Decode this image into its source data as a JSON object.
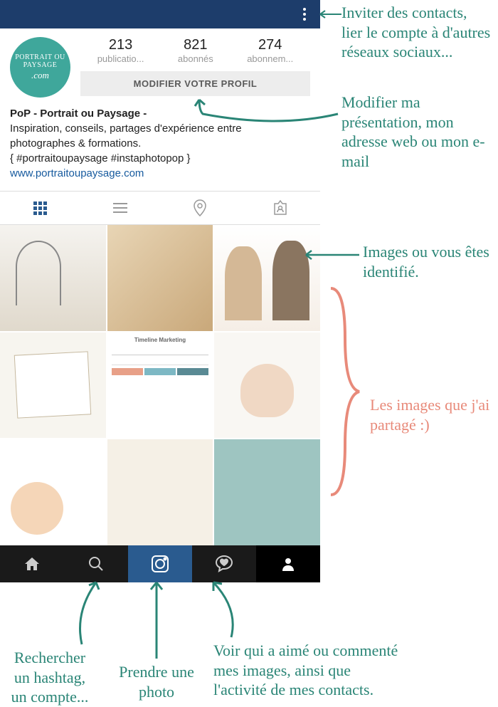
{
  "profile": {
    "avatar_line1": "PORTRAIT OU PAYSAGE",
    "avatar_line2": ".com",
    "stats": {
      "posts": {
        "count": "213",
        "label": "publicatio..."
      },
      "followers": {
        "count": "821",
        "label": "abonnés"
      },
      "following": {
        "count": "274",
        "label": "abonnem..."
      }
    },
    "edit_button": "MODIFIER VOTRE PROFIL",
    "name": "PoP - Portrait ou Paysage -",
    "bio_line1": "Inspiration, conseils, partages d'expérience entre",
    "bio_line2": "photographes & formations.",
    "bio_line3": "{ #portraitoupaysage #instaphotopop }",
    "url": "www.portraitoupaysage.com"
  },
  "grid": {
    "timeline_title": "Timeline Marketing"
  },
  "annotations": {
    "menu": "Inviter des contacts, lier le compte à d'autres réseaux sociaux...",
    "edit": "Modifier ma présentation, mon adresse web ou mon e-mail",
    "tagged": "Images ou vous êtes identifié.",
    "shared": "Les images que j'ai partagé :)",
    "search": "Rechercher un hashtag, un compte...",
    "camera": "Prendre une photo",
    "activity": "Voir qui a aimé ou commenté mes images, ainsi que l'activité de mes contacts."
  },
  "colors": {
    "teal": "#2a8576",
    "coral": "#e88a7a",
    "navy": "#1d3d6b",
    "instablue": "#2a5b8f"
  }
}
